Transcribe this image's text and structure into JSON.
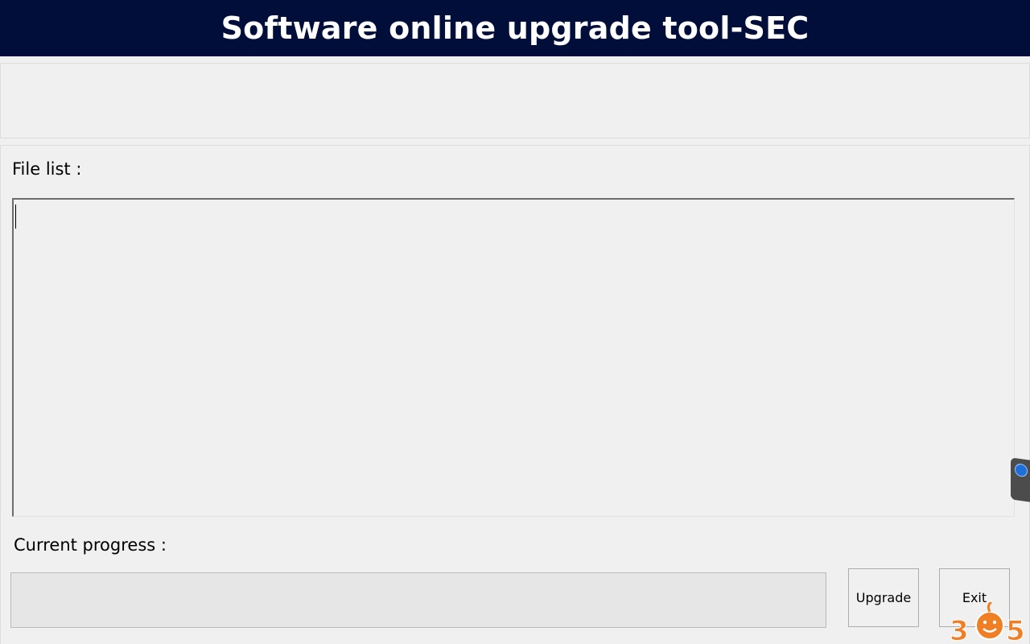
{
  "window": {
    "title": "Software online upgrade tool-SEC"
  },
  "file_list": {
    "label": "File list :",
    "items": []
  },
  "progress": {
    "label": "Current progress :",
    "value": 0
  },
  "buttons": {
    "upgrade": "Upgrade",
    "exit": "Exit"
  },
  "watermark": {
    "text": "365"
  },
  "colors": {
    "title_bar": "#020e3a",
    "title_text": "#ffffff",
    "background": "#f0f0f0",
    "progress_fill": "#06b025",
    "watermark": "#f07f23"
  },
  "icons": {
    "side_tab": "teamviewer-icon"
  }
}
